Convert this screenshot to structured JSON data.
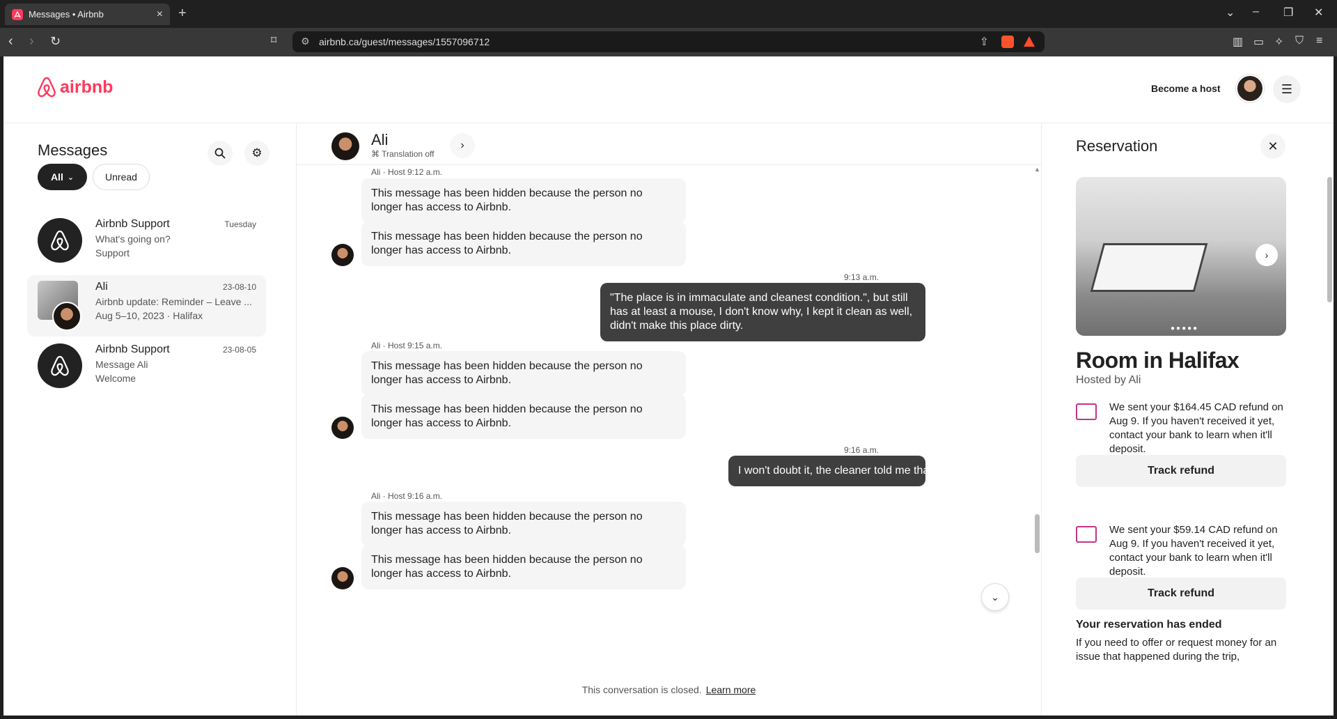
{
  "browser": {
    "tab_title": "Messages • Airbnb",
    "url": "airbnb.ca/guest/messages/1557096712"
  },
  "header": {
    "logo_text": "airbnb",
    "become_host": "Become a host",
    "brand_color": "#ff385c"
  },
  "sidebar": {
    "title": "Messages",
    "filters": {
      "all": "All",
      "unread": "Unread"
    },
    "conversations": [
      {
        "name": "Airbnb Support",
        "date": "Tuesday",
        "line1": "What's going on?",
        "line2": "Support"
      },
      {
        "name": "Ali",
        "date": "23-08-10",
        "line1": "Airbnb update: Reminder – Leave ...",
        "line2": "Aug 5–10, 2023 · Halifax"
      },
      {
        "name": "Airbnb Support",
        "date": "23-08-05",
        "line1": "Message Ali",
        "line2": "Welcome"
      }
    ]
  },
  "chat": {
    "name": "Ali",
    "translation": "Translation off",
    "messages": [
      {
        "meta": "Ali · Host 9:12 a.m."
      },
      {
        "text": "This message has been hidden because the person no longer has access to Airbnb."
      },
      {
        "text": "This message has been hidden because the person no longer has access to Airbnb."
      },
      {
        "meta": "9:13 a.m."
      },
      {
        "text": "\"The place is in immaculate and cleanest condition.\", but still has at least a mouse, I don't know why, I kept it clean as well, didn't make this place dirty."
      },
      {
        "meta": "Ali · Host 9:15 a.m."
      },
      {
        "text": "This message has been hidden because the person no longer has access to Airbnb."
      },
      {
        "text": "This message has been hidden because the person no longer has access to Airbnb."
      },
      {
        "meta": "9:16 a.m."
      },
      {
        "text": "I won't doubt it, the cleaner told me that already."
      },
      {
        "meta": "Ali · Host 9:16 a.m."
      },
      {
        "text": "This message has been hidden because the person no longer has access to Airbnb."
      },
      {
        "text": "This message has been hidden because the person no longer has access to Airbnb."
      }
    ],
    "closed_note": "This conversation is closed.",
    "learn_more": "Learn more"
  },
  "reservation": {
    "title": "Reservation",
    "room": "Room in Halifax",
    "host": "Hosted by Ali",
    "refunds": [
      {
        "text": "We sent your $164.45 CAD refund on Aug 9. If you haven't received it yet, contact your bank to learn when it'll deposit.",
        "button": "Track refund"
      },
      {
        "text": "We sent your $59.14 CAD refund on Aug 9. If you haven't received it yet, contact your bank to learn when it'll deposit.",
        "button": "Track refund"
      }
    ],
    "ended_title": "Your reservation has ended",
    "ended_text": "If you need to offer or request money for an issue that happened during the trip,"
  }
}
